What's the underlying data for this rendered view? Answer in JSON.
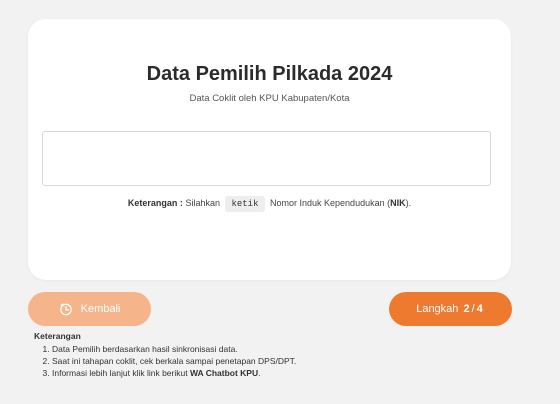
{
  "card": {
    "title": "Data Pemilih Pilkada 2024",
    "subtitle": "Data Coklit oleh KPU Kabupaten/Kota",
    "input_value": "",
    "hint": {
      "label": "Keterangan :",
      "text_before": "Silahkan",
      "kbd": "ketik",
      "text_middle": "Nomor Induk Kependudukan (",
      "abbr": "NIK",
      "text_after": ")."
    }
  },
  "buttons": {
    "back_label": "Kembali",
    "back_icon": "clock-back-icon",
    "next_label": "Langkah",
    "step_current": "2",
    "step_sep": "/",
    "step_total": "4"
  },
  "notes": {
    "title": "Keterangan",
    "items": [
      "Data Pemilih berdasarkan hasil sinkronisasi data.",
      "Saat ini tahapan coklit, cek berkala sampai penetapan DPS/DPT."
    ],
    "item3_text": "Informasi lebih lanjut klik link berikut",
    "item3_link": "WA Chatbot KPU",
    "item3_end": "."
  },
  "colors": {
    "primary": "#ee7a2f",
    "primary_light": "#f6b48a",
    "background": "#f2f2f2"
  }
}
